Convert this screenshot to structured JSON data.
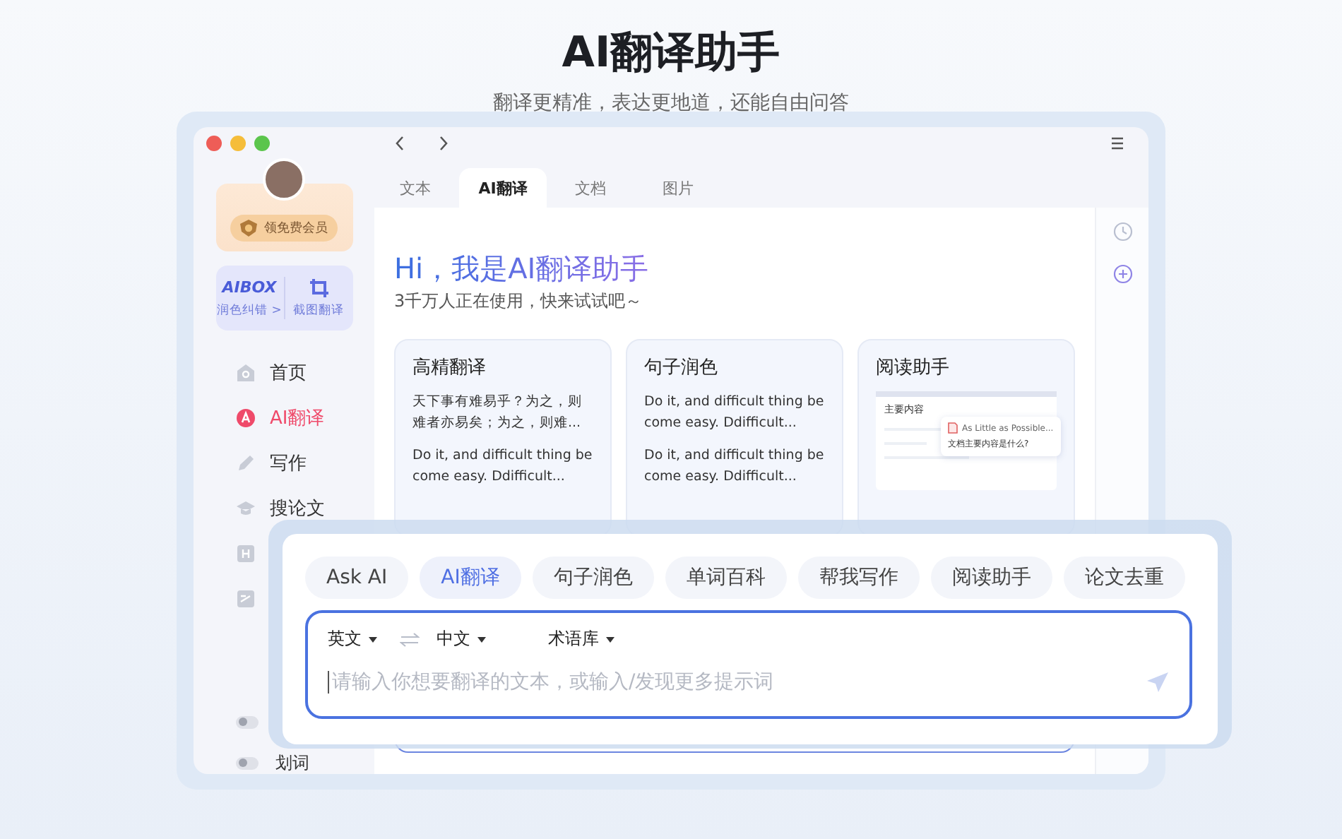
{
  "page": {
    "title": "AI翻译助手",
    "subtitle": "翻译更精准，表达更地道，还能自由问答"
  },
  "sidebar": {
    "member_button": "领免费会员",
    "aibox": {
      "logo": "AIBOX",
      "link": "润色纠错 >",
      "tool": "截图翻译"
    },
    "items": [
      {
        "kind": "home",
        "label": "首页",
        "selected": false
      },
      {
        "kind": "ai",
        "label": "AI翻译",
        "selected": true
      },
      {
        "kind": "pen",
        "label": "写作",
        "selected": false
      },
      {
        "kind": "cap",
        "label": "搜论文",
        "selected": false
      },
      {
        "kind": "heading",
        "selected": false
      },
      {
        "kind": "note",
        "selected": false
      }
    ],
    "toggles": [
      {
        "on": false
      },
      {
        "label": "划词",
        "on": false
      }
    ]
  },
  "tabs": [
    {
      "label": "文本",
      "selected": false
    },
    {
      "label": "AI翻译",
      "selected": true
    },
    {
      "label": "文档",
      "selected": false
    },
    {
      "label": "图片",
      "selected": false
    }
  ],
  "hero": {
    "title": "Hi，我是AI翻译助手",
    "subtitle": "3千万人正在使用，快来试试吧～"
  },
  "cards": [
    {
      "kind": "text",
      "title": "高精翻译",
      "paragraphs": [
        "天下事有难易乎？为之，则难者亦易矣；为之，则难...",
        "Do it, and difficult thing be come easy. Ddifficult..."
      ]
    },
    {
      "kind": "text",
      "title": "句子润色",
      "paragraphs": [
        "Do it, and difficult thing be come easy. Ddifficult...",
        "Do it, and difficult thing be come easy. Ddifficult..."
      ]
    },
    {
      "kind": "preview",
      "title": "阅读助手",
      "preview": {
        "heading": "主要内容",
        "file": "As Little as Possible...",
        "question": "文档主要内容是什么?"
      }
    }
  ],
  "quick_panel": {
    "chips": [
      {
        "label": "Ask AI",
        "selected": false
      },
      {
        "label": "AI翻译",
        "selected": true
      },
      {
        "label": "句子润色",
        "selected": false
      },
      {
        "label": "单词百科",
        "selected": false
      },
      {
        "label": "帮我写作",
        "selected": false
      },
      {
        "label": "阅读助手",
        "selected": false
      },
      {
        "label": "论文去重",
        "selected": false
      }
    ],
    "source_lang": "英文",
    "target_lang": "中文",
    "glossary": "术语库",
    "placeholder": "请输入你想要翻译的文本，或输入/发现更多提示词"
  }
}
